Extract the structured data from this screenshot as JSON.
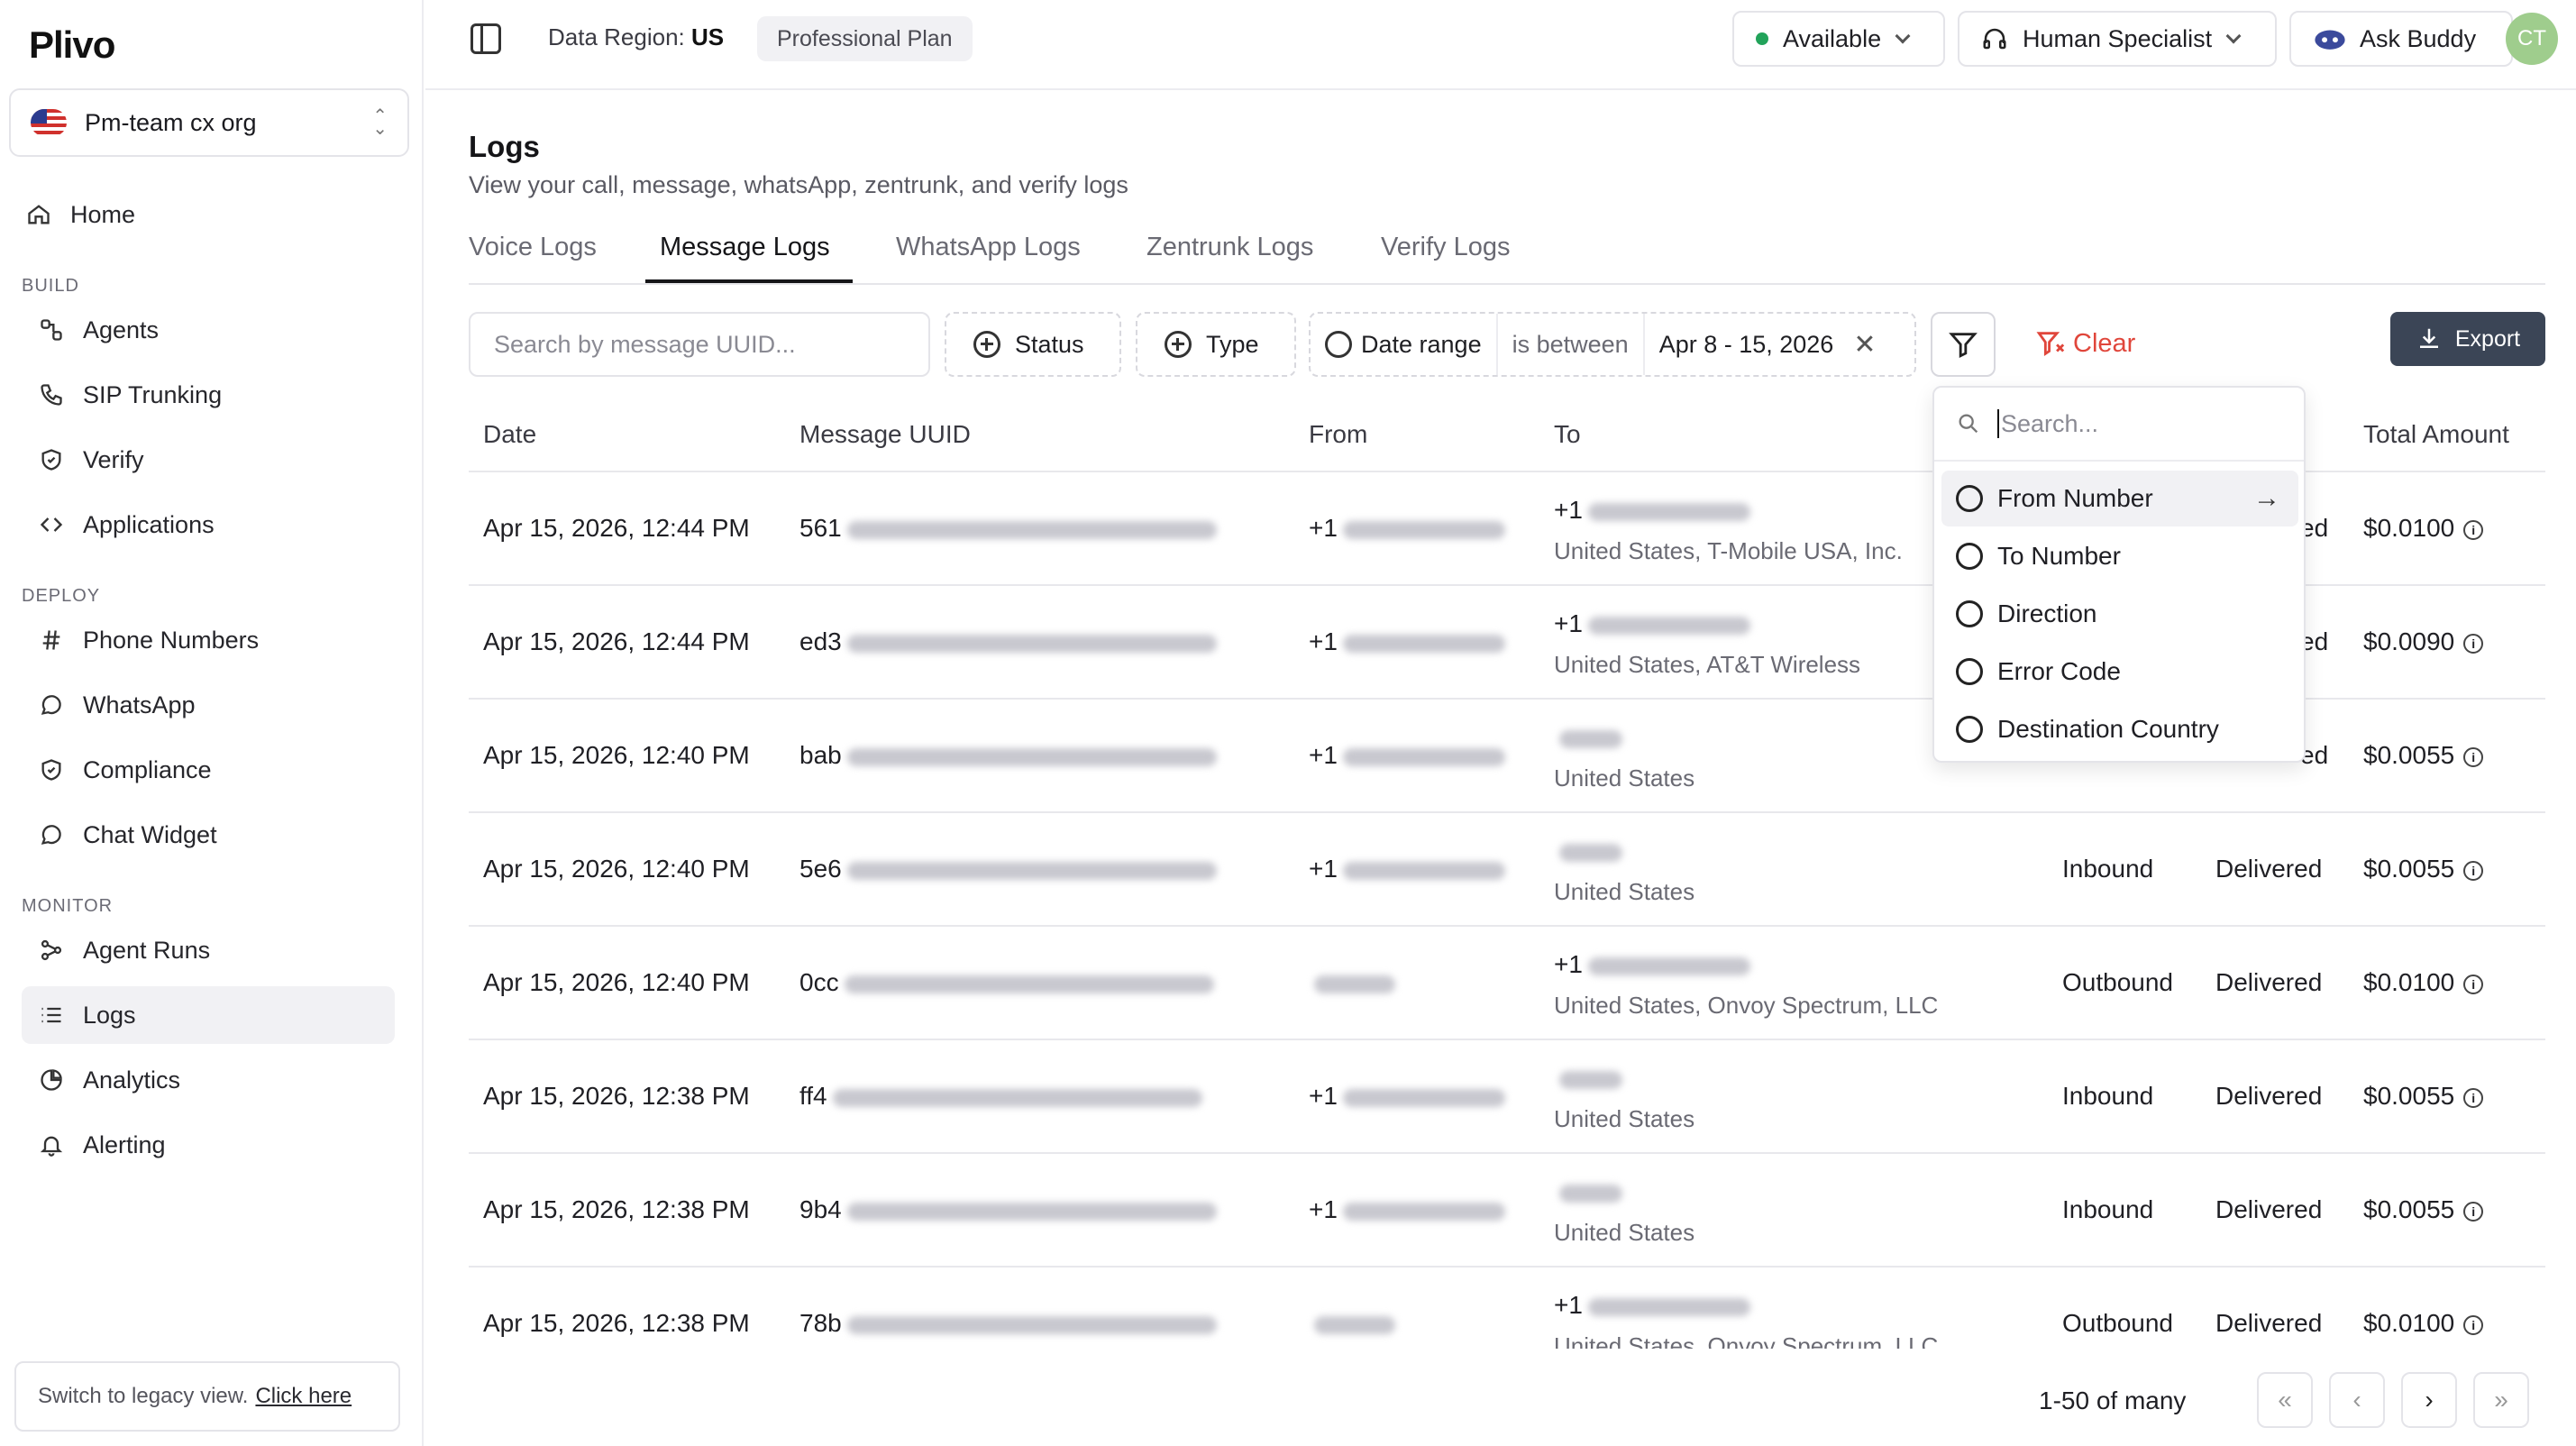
{
  "app": {
    "logo": "Plivo"
  },
  "sidebar": {
    "org_name": "Pm-team cx org",
    "home": "Home",
    "sections": {
      "build": "BUILD",
      "deploy": "DEPLOY",
      "monitor": "MONITOR"
    },
    "build_items": [
      "Agents",
      "SIP Trunking",
      "Verify",
      "Applications"
    ],
    "deploy_items": [
      "Phone Numbers",
      "WhatsApp",
      "Compliance",
      "Chat Widget"
    ],
    "monitor_items": [
      "Agent Runs",
      "Logs",
      "Analytics",
      "Alerting"
    ],
    "legacy_text": "Switch to legacy view.",
    "legacy_link": "Click here"
  },
  "topbar": {
    "region_label": "Data Region:",
    "region_value": "US",
    "plan": "Professional Plan",
    "status": "Available",
    "specialist": "Human Specialist",
    "ask_buddy": "Ask Buddy",
    "avatar_initials": "CT"
  },
  "page": {
    "title": "Logs",
    "subtitle": "View your call, message, whatsApp, zentrunk, and verify logs",
    "tabs": [
      "Voice Logs",
      "Message Logs",
      "WhatsApp Logs",
      "Zentrunk Logs",
      "Verify Logs"
    ],
    "active_tab": "Message Logs"
  },
  "filters": {
    "search_placeholder": "Search by message UUID...",
    "status": "Status",
    "type": "Type",
    "date_range_label": "Date range",
    "date_operator": "is between",
    "date_value": "Apr 8 - 15, 2026",
    "clear": "Clear",
    "export": "Export"
  },
  "filter_menu": {
    "search_placeholder": "Search...",
    "items": [
      "From Number",
      "To Number",
      "Direction",
      "Error Code",
      "Destination Country"
    ]
  },
  "table": {
    "columns": [
      "Date",
      "Message UUID",
      "From",
      "To",
      "Total Amount"
    ],
    "rows": [
      {
        "date": "Apr 15, 2026, 12:44 PM",
        "uuid": "561",
        "from": "+1",
        "to_line1": "+1",
        "to_line2": "United States, T-Mobile USA, Inc.",
        "direction": "",
        "status": "ed",
        "amount": "$0.0100"
      },
      {
        "date": "Apr 15, 2026, 12:44 PM",
        "uuid": "ed3",
        "from": "+1",
        "to_line1": "+1",
        "to_line2": "United States, AT&T Wireless",
        "direction": "",
        "status": "ed",
        "amount": "$0.0090"
      },
      {
        "date": "Apr 15, 2026, 12:40 PM",
        "uuid": "bab",
        "from": "+1",
        "to_line1": "",
        "to_line2": "United States",
        "direction": "",
        "status": "ed",
        "amount": "$0.0055"
      },
      {
        "date": "Apr 15, 2026, 12:40 PM",
        "uuid": "5e6",
        "from": "+1",
        "to_line1": "",
        "to_line2": "United States",
        "direction": "Inbound",
        "status": "Delivered",
        "amount": "$0.0055"
      },
      {
        "date": "Apr 15, 2026, 12:40 PM",
        "uuid": "0cc",
        "from": "",
        "to_line1": "+1",
        "to_line2": "United States, Onvoy Spectrum, LLC",
        "direction": "Outbound",
        "status": "Delivered",
        "amount": "$0.0100"
      },
      {
        "date": "Apr 15, 2026, 12:38 PM",
        "uuid": "ff4",
        "from": "+1",
        "to_line1": "",
        "to_line2": "United States",
        "direction": "Inbound",
        "status": "Delivered",
        "amount": "$0.0055"
      },
      {
        "date": "Apr 15, 2026, 12:38 PM",
        "uuid": "9b4",
        "from": "+1",
        "to_line1": "",
        "to_line2": "United States",
        "direction": "Inbound",
        "status": "Delivered",
        "amount": "$0.0055"
      },
      {
        "date": "Apr 15, 2026, 12:38 PM",
        "uuid": "78b",
        "from": "",
        "to_line1": "+1",
        "to_line2": "United States, Onvoy Spectrum, LLC",
        "direction": "Outbound",
        "status": "Delivered",
        "amount": "$0.0100"
      }
    ]
  },
  "pagination": {
    "range": "1-50 of many",
    "first": "«",
    "prev": "‹",
    "next": "›",
    "last": "»"
  },
  "colors": {
    "accent": "#3b4556",
    "danger": "#e0463b",
    "available": "#22a35a",
    "avatar": "#9fcd8d"
  }
}
